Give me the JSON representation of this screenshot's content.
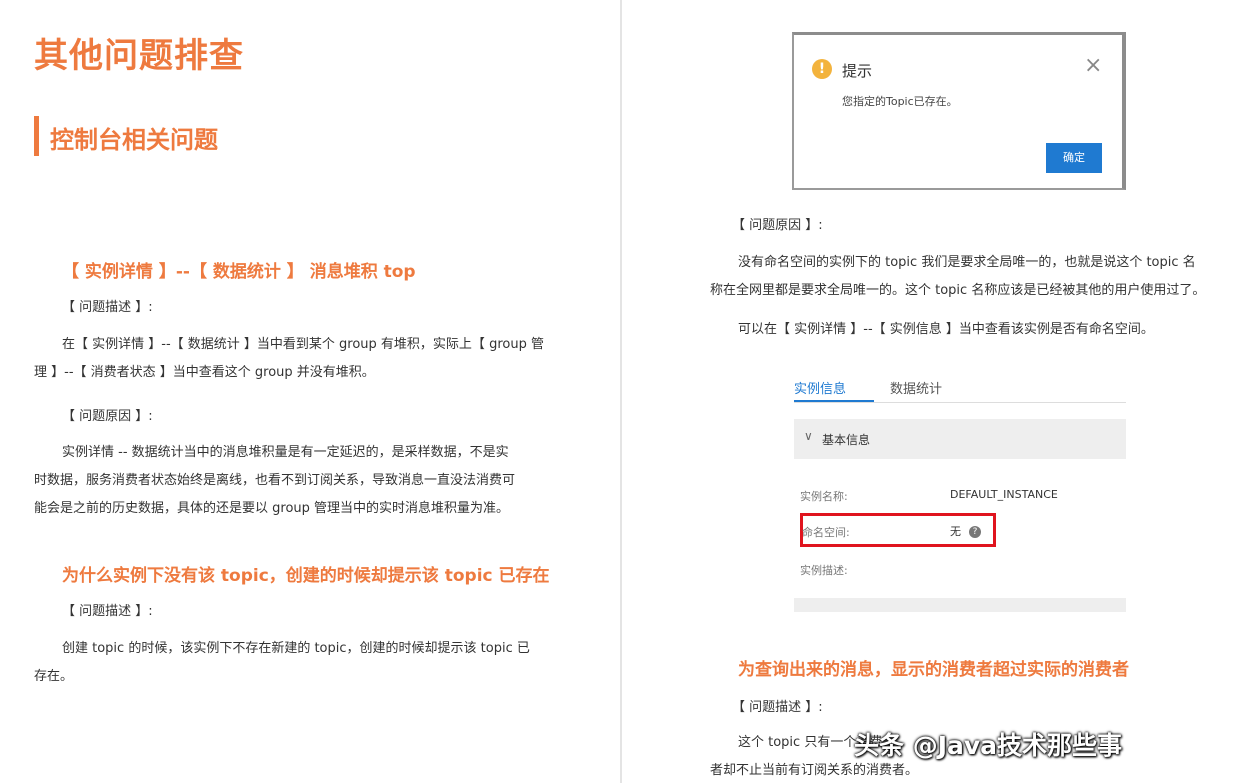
{
  "left": {
    "title": "其他问题排查",
    "section": "控制台相关问题",
    "q1": {
      "heading": "【 实例详情 】--【 数据统计 】 消息堆积 top",
      "desc_label": "【 问题描述 】:",
      "desc_l1": "在【 实例详情 】--【 数据统计 】当中看到某个 group 有堆积，实际上【 group 管",
      "desc_l2": "理 】--【 消费者状态 】当中查看这个 group 并没有堆积。",
      "cause_label": "【 问题原因 】:",
      "cause_l1": "实例详情 -- 数据统计当中的消息堆积量是有一定延迟的，是采样数据，不是实",
      "cause_l2": "时数据，服务消费者状态始终是离线，也看不到订阅关系，导致消息一直没法消费可",
      "cause_l3": "能会是之前的历史数据，具体的还是要以 group 管理当中的实时消息堆积量为准。"
    },
    "q2": {
      "heading": "为什么实例下没有该 topic，创建的时候却提示该 topic 已存在",
      "desc_label": "【 问题描述 】:",
      "desc_l1": "创建 topic 的时候，该实例下不存在新建的 topic，创建的时候却提示该 topic 已",
      "desc_l2": "存在。"
    }
  },
  "right": {
    "dialog": {
      "icon": "warning-icon",
      "title": "提示",
      "message": "您指定的Topic已存在。",
      "ok": "确定",
      "close": "×"
    },
    "cause_label": "【 问题原因 】:",
    "cause_l1": "没有命名空间的实例下的 topic 我们是要求全局唯一的，也就是说这个 topic 名",
    "cause_l2": "称在全网里都是要求全局唯一的。这个 topic 名称应该是已经被其他的用户使用过了。",
    "tip": "可以在【 实例详情 】--【 实例信息 】当中查看该实例是否有命名空间。",
    "panel": {
      "tab_active": "实例信息",
      "tab_other": "数据统计",
      "section": "基本信息",
      "name_key": "实例名称:",
      "name_val": "DEFAULT_INSTANCE",
      "ns_key": "命名空间:",
      "ns_val": "无",
      "desc_key": "实例描述:"
    },
    "q3": {
      "heading": "为查询出来的消息，显示的消费者超过实际的消费者",
      "desc_label": "【 问题描述 】:",
      "desc_l1": "这个 topic 只有一个消费",
      "desc_l2": "者却不止当前有订阅关系的消费者。"
    },
    "watermark": "头条 @Java技术那些事"
  },
  "colors": {
    "accent": "#ee7a3f",
    "primary": "#1f7ad1",
    "highlight": "#e0141e"
  }
}
